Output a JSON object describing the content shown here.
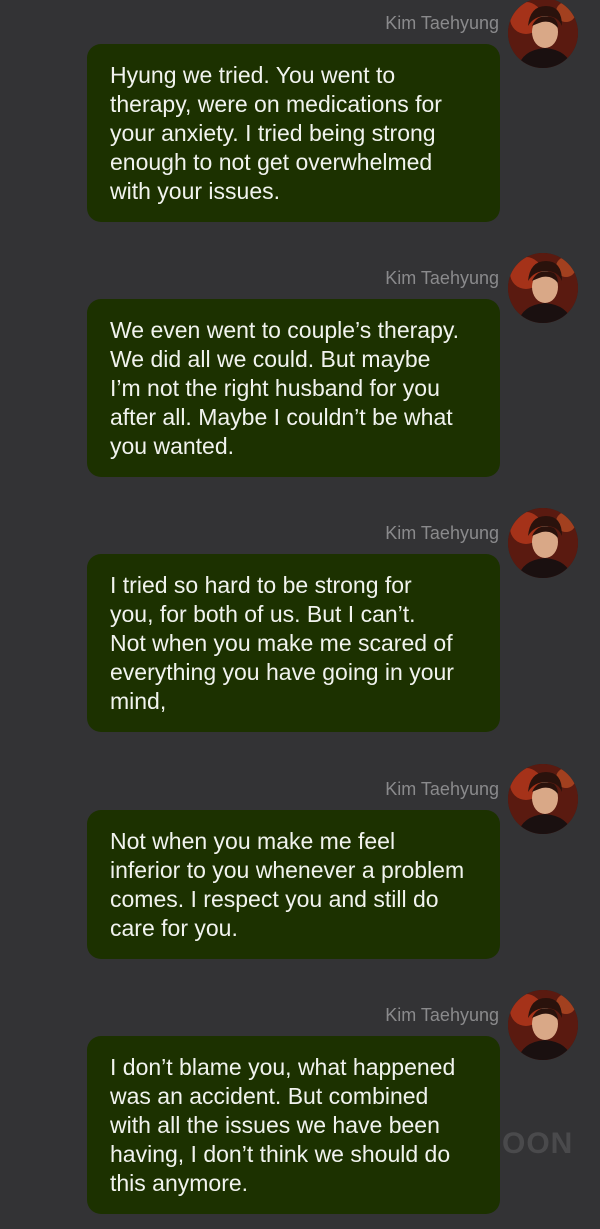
{
  "messages": [
    {
      "sender": "Kim Taehyung",
      "avatar_icon": "profile-photo",
      "text": "Hyung we tried. You went to\ntherapy, were on medications for\nyour anxiety. I tried being strong\nenough to not get overwhelmed\nwith your issues."
    },
    {
      "sender": "Kim Taehyung",
      "avatar_icon": "profile-photo",
      "text": "We even went to couple’s therapy.\nWe did all we could. But maybe\nI’m not the right husband for you\nafter all. Maybe I couldn’t be what\nyou wanted."
    },
    {
      "sender": "Kim Taehyung",
      "avatar_icon": "profile-photo",
      "text": "I tried so hard to be strong for\nyou, for both of us. But I can’t.\nNot when you make me scared of\neverything you have going in your\nmind,"
    },
    {
      "sender": "Kim Taehyung",
      "avatar_icon": "profile-photo",
      "text": "Not when you make me feel\ninferior to you whenever a problem\ncomes. I respect you and still do\ncare for you."
    },
    {
      "sender": "Kim Taehyung",
      "avatar_icon": "profile-photo",
      "text": "I don’t blame you, what happened\nwas an accident. But combined\nwith all the issues we have been\nhaving, I don’t think we should do\nthis anymore."
    }
  ],
  "watermark": "OON",
  "colors": {
    "background": "#333335",
    "bubble": "#1c3100",
    "bubble_text": "#f1f3ee",
    "sender_name": "#8a8a8c"
  }
}
